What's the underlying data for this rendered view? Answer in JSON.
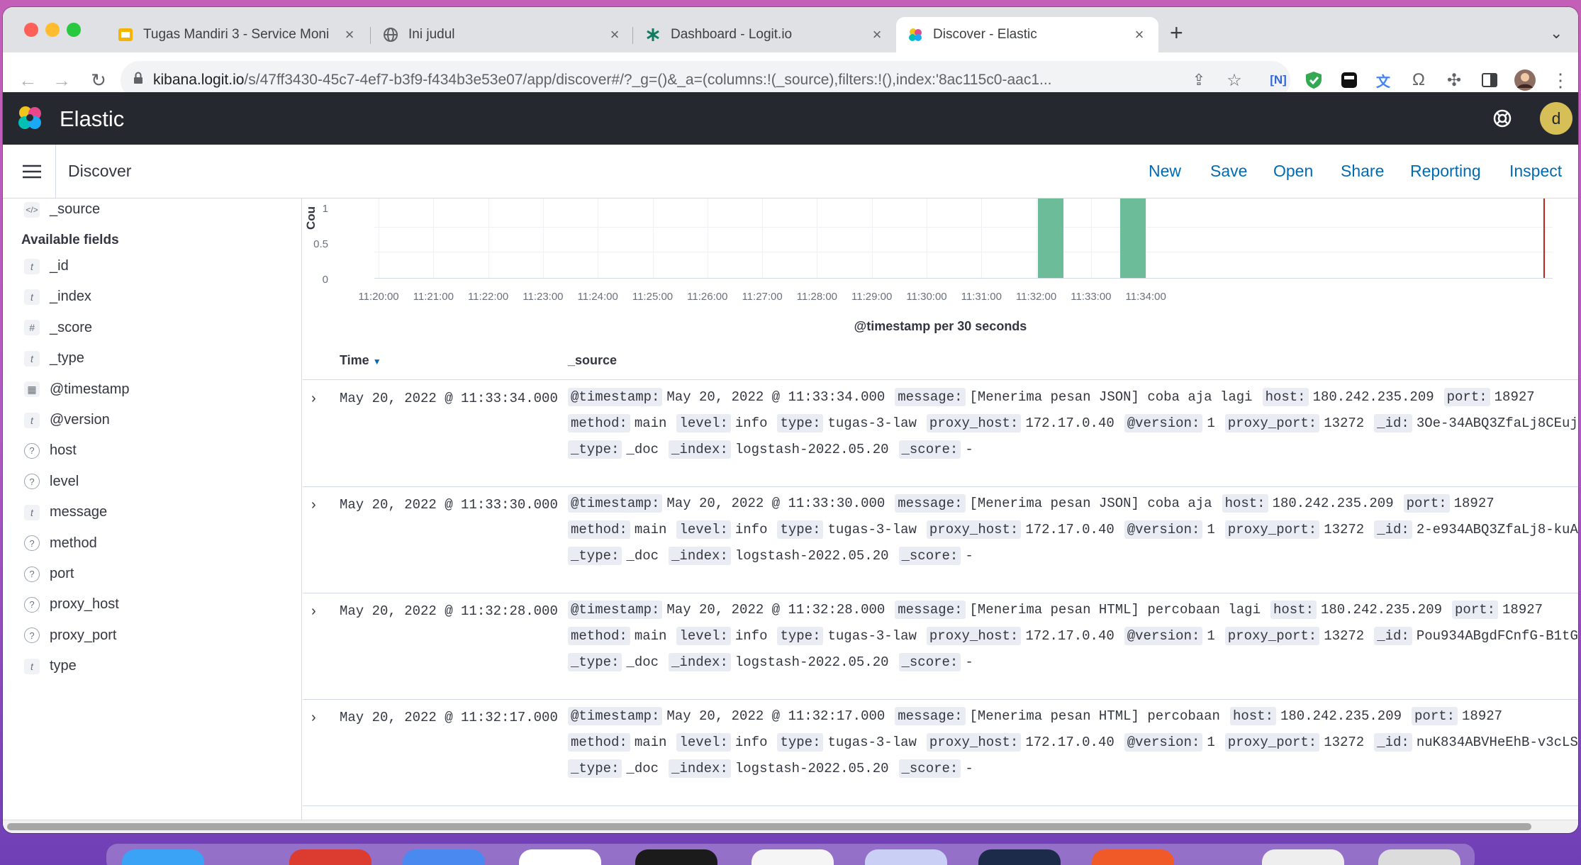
{
  "browser": {
    "tabs": [
      {
        "title": "Tugas Mandiri 3 - Service Moni",
        "icon": "slides-icon"
      },
      {
        "title": "Ini judul",
        "icon": "globe-icon"
      },
      {
        "title": "Dashboard - Logit.io",
        "icon": "logit-icon"
      },
      {
        "title": "Discover - Elastic",
        "icon": "elastic-icon",
        "active": true
      }
    ],
    "url_domain": "kibana.logit.io",
    "url_path": "/s/47ff3430-45c7-4ef7-b3f9-f434b3e53e07/app/discover#/?_g=()&_a=(columns:!(_source),filters:!(),index:'8ac115c0-aac1...",
    "colors": {
      "tabstrip": "#dfe1e5",
      "active_tab": "#ffffff"
    }
  },
  "kibana": {
    "brand": "Elastic",
    "avatar_letter": "d",
    "page_title": "Discover",
    "menu": [
      "New",
      "Save",
      "Open",
      "Share",
      "Reporting",
      "Inspect"
    ],
    "colors": {
      "header_bg": "#25282f",
      "link": "#006bb4",
      "bar": "#6dbc99",
      "now_marker": "#bd271e"
    }
  },
  "sidebar": {
    "selected_field": "_source",
    "available_header": "Available fields",
    "fields": [
      {
        "name": "_id",
        "type": "t"
      },
      {
        "name": "_index",
        "type": "t"
      },
      {
        "name": "_score",
        "type": "#"
      },
      {
        "name": "_type",
        "type": "t"
      },
      {
        "name": "@timestamp",
        "type": "date"
      },
      {
        "name": "@version",
        "type": "t"
      },
      {
        "name": "host",
        "type": "?"
      },
      {
        "name": "level",
        "type": "?"
      },
      {
        "name": "message",
        "type": "t"
      },
      {
        "name": "method",
        "type": "?"
      },
      {
        "name": "port",
        "type": "?"
      },
      {
        "name": "proxy_host",
        "type": "?"
      },
      {
        "name": "proxy_port",
        "type": "?"
      },
      {
        "name": "type",
        "type": "t"
      }
    ]
  },
  "chart_data": {
    "type": "bar",
    "ylabel": "Cou",
    "yticks": [
      "1",
      "0.5",
      "0"
    ],
    "ylim": [
      0,
      1.5
    ],
    "x_ticks": [
      "11:20:00",
      "11:21:00",
      "11:22:00",
      "11:23:00",
      "11:24:00",
      "11:25:00",
      "11:26:00",
      "11:27:00",
      "11:28:00",
      "11:29:00",
      "11:30:00",
      "11:31:00",
      "11:32:00",
      "11:33:00",
      "11:34:00"
    ],
    "bars": [
      {
        "x": "11:32:00",
        "value": 2
      },
      {
        "x": "11:33:30",
        "value": 2
      }
    ],
    "xlabel": "@timestamp per 30 seconds"
  },
  "table": {
    "col_time": "Time",
    "col_source": "_source",
    "rows": [
      {
        "time": "May 20, 2022 @ 11:33:34.000",
        "lines": [
          [
            [
              "@timestamp:",
              "May 20, 2022 @ 11:33:34.000"
            ],
            [
              "message:",
              "[Menerima pesan JSON] coba aja lagi"
            ],
            [
              "host:",
              "180.242.235.209"
            ],
            [
              "port:",
              "18927"
            ]
          ],
          [
            [
              "method:",
              "main"
            ],
            [
              "level:",
              "info"
            ],
            [
              "type:",
              "tugas-3-law"
            ],
            [
              "proxy_host:",
              "172.17.0.40"
            ],
            [
              "@version:",
              "1"
            ],
            [
              "proxy_port:",
              "13272"
            ],
            [
              "_id:",
              "3Oe-34ABQ3ZfaLj8CEuj"
            ]
          ],
          [
            [
              "_type:",
              "_doc"
            ],
            [
              "_index:",
              "logstash-2022.05.20"
            ],
            [
              "_score:",
              "-"
            ]
          ]
        ]
      },
      {
        "time": "May 20, 2022 @ 11:33:30.000",
        "lines": [
          [
            [
              "@timestamp:",
              "May 20, 2022 @ 11:33:30.000"
            ],
            [
              "message:",
              "[Menerima pesan JSON] coba aja"
            ],
            [
              "host:",
              "180.242.235.209"
            ],
            [
              "port:",
              "18927"
            ]
          ],
          [
            [
              "method:",
              "main"
            ],
            [
              "level:",
              "info"
            ],
            [
              "type:",
              "tugas-3-law"
            ],
            [
              "proxy_host:",
              "172.17.0.40"
            ],
            [
              "@version:",
              "1"
            ],
            [
              "proxy_port:",
              "13272"
            ],
            [
              "_id:",
              "2-e934ABQ3ZfaLj8-kuA"
            ]
          ],
          [
            [
              "_type:",
              "_doc"
            ],
            [
              "_index:",
              "logstash-2022.05.20"
            ],
            [
              "_score:",
              "-"
            ]
          ]
        ]
      },
      {
        "time": "May 20, 2022 @ 11:32:28.000",
        "lines": [
          [
            [
              "@timestamp:",
              "May 20, 2022 @ 11:32:28.000"
            ],
            [
              "message:",
              "[Menerima pesan HTML] percobaan lagi"
            ],
            [
              "host:",
              "180.242.235.209"
            ],
            [
              "port:",
              "18927"
            ]
          ],
          [
            [
              "method:",
              "main"
            ],
            [
              "level:",
              "info"
            ],
            [
              "type:",
              "tugas-3-law"
            ],
            [
              "proxy_host:",
              "172.17.0.40"
            ],
            [
              "@version:",
              "1"
            ],
            [
              "proxy_port:",
              "13272"
            ],
            [
              "_id:",
              "Pou934ABgdFCnfG-B1tG"
            ]
          ],
          [
            [
              "_type:",
              "_doc"
            ],
            [
              "_index:",
              "logstash-2022.05.20"
            ],
            [
              "_score:",
              "-"
            ]
          ]
        ]
      },
      {
        "time": "May 20, 2022 @ 11:32:17.000",
        "lines": [
          [
            [
              "@timestamp:",
              "May 20, 2022 @ 11:32:17.000"
            ],
            [
              "message:",
              "[Menerima pesan HTML] percobaan"
            ],
            [
              "host:",
              "180.242.235.209"
            ],
            [
              "port:",
              "18927"
            ]
          ],
          [
            [
              "method:",
              "main"
            ],
            [
              "level:",
              "info"
            ],
            [
              "type:",
              "tugas-3-law"
            ],
            [
              "proxy_host:",
              "172.17.0.40"
            ],
            [
              "@version:",
              "1"
            ],
            [
              "proxy_port:",
              "13272"
            ],
            [
              "_id:",
              "nuK834ABVHeEhB-v3cLS"
            ]
          ],
          [
            [
              "_type:",
              "_doc"
            ],
            [
              "_index:",
              "logstash-2022.05.20"
            ],
            [
              "_score:",
              "-"
            ]
          ]
        ]
      }
    ]
  }
}
